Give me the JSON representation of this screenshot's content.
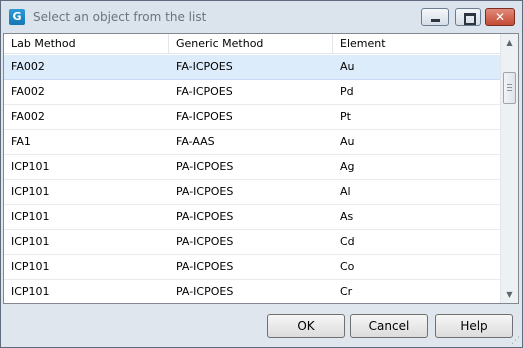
{
  "window": {
    "app_icon_letter": "G",
    "title": "Select an object from the list"
  },
  "table": {
    "columns": [
      "Lab Method",
      "Generic Method",
      "Element"
    ],
    "rows": [
      [
        "FA002",
        "FA-ICPOES",
        "Au"
      ],
      [
        "FA002",
        "FA-ICPOES",
        "Pd"
      ],
      [
        "FA002",
        "FA-ICPOES",
        "Pt"
      ],
      [
        "FA1",
        "FA-AAS",
        "Au"
      ],
      [
        "ICP101",
        "PA-ICPOES",
        "Ag"
      ],
      [
        "ICP101",
        "PA-ICPOES",
        "Al"
      ],
      [
        "ICP101",
        "PA-ICPOES",
        "As"
      ],
      [
        "ICP101",
        "PA-ICPOES",
        "Cd"
      ],
      [
        "ICP101",
        "PA-ICPOES",
        "Co"
      ],
      [
        "ICP101",
        "PA-ICPOES",
        "Cr"
      ]
    ],
    "selected_row": 0
  },
  "buttons": {
    "ok": "OK",
    "cancel": "Cancel",
    "help": "Help"
  }
}
